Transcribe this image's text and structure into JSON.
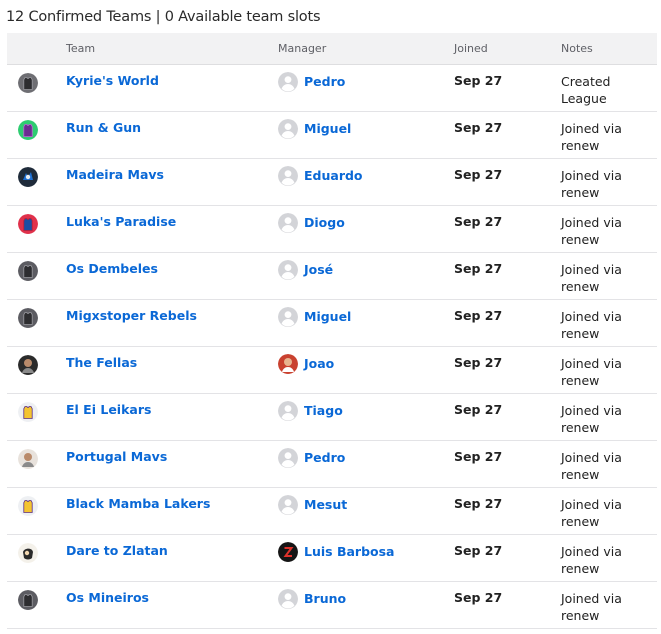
{
  "summary": "12 Confirmed Teams | 0 Available team slots",
  "columns": {
    "team": "Team",
    "manager": "Manager",
    "joined": "Joined",
    "notes": "Notes"
  },
  "rows": [
    {
      "logo_icon": "jersey-gray-logo-icon",
      "logo_bg": "#6e6e73",
      "team": "Kyrie's World",
      "avatar_icon": "default-user-icon",
      "manager": "Pedro",
      "joined": "Sep 27",
      "notes": "Created League"
    },
    {
      "logo_icon": "jersey-purple-logo-icon",
      "logo_bg": "#2ecc71",
      "team": "Run & Gun",
      "avatar_icon": "default-user-icon",
      "manager": "Miguel",
      "joined": "Sep 27",
      "notes": "Joined via renew"
    },
    {
      "logo_icon": "mavs-logo-icon",
      "logo_bg": "#1f2b3a",
      "team": "Madeira Mavs",
      "avatar_icon": "default-user-icon",
      "manager": "Eduardo",
      "joined": "Sep 27",
      "notes": "Joined via renew"
    },
    {
      "logo_icon": "jersey-blue-logo-icon",
      "logo_bg": "#e0314b",
      "team": "Luka's Paradise",
      "avatar_icon": "default-user-icon",
      "manager": "Diogo",
      "joined": "Sep 27",
      "notes": "Joined via renew"
    },
    {
      "logo_icon": "jersey-gray-logo-icon",
      "logo_bg": "#5c5c62",
      "team": "Os Dembeles",
      "avatar_icon": "default-user-icon",
      "manager": "José",
      "joined": "Sep 27",
      "notes": "Joined via renew"
    },
    {
      "logo_icon": "jersey-gray-logo-icon",
      "logo_bg": "#5c5c62",
      "team": "Migxstoper Rebels",
      "avatar_icon": "default-user-icon",
      "manager": "Miguel",
      "joined": "Sep 27",
      "notes": "Joined via renew"
    },
    {
      "logo_icon": "player-photo-logo-icon",
      "logo_bg": "#2b2b2b",
      "team": "The Fellas",
      "avatar_icon": "user-photo-avatar-icon",
      "manager": "Joao",
      "joined": "Sep 27",
      "notes": "Joined via renew"
    },
    {
      "logo_icon": "lakers-jersey-logo-icon",
      "logo_bg": "#eef0f3",
      "team": "El Ei Leikars",
      "avatar_icon": "default-user-icon",
      "manager": "Tiago",
      "joined": "Sep 27",
      "notes": "Joined via renew"
    },
    {
      "logo_icon": "player-photo-logo-icon",
      "logo_bg": "#e8e2dc",
      "team": "Portugal Mavs",
      "avatar_icon": "default-user-icon",
      "manager": "Pedro",
      "joined": "Sep 27",
      "notes": "Joined via renew"
    },
    {
      "logo_icon": "lakers-jersey-logo-icon",
      "logo_bg": "#eef0f3",
      "team": "Black Mamba Lakers",
      "avatar_icon": "default-user-icon",
      "manager": "Mesut",
      "joined": "Sep 27",
      "notes": "Joined via renew"
    },
    {
      "logo_icon": "cartoon-logo-icon",
      "logo_bg": "#f4f1ea",
      "team": "Dare to Zlatan",
      "avatar_icon": "letter-z-avatar-icon",
      "manager": "Luis Barbosa",
      "joined": "Sep 27",
      "notes": "Joined via renew"
    },
    {
      "logo_icon": "jersey-gray-logo-icon",
      "logo_bg": "#5c5c62",
      "team": "Os Mineiros",
      "avatar_icon": "default-user-icon",
      "manager": "Bruno",
      "joined": "Sep 27",
      "notes": "Joined via renew"
    }
  ],
  "colors": {
    "link": "#0a68d6",
    "header_bg": "#f2f2f3",
    "divider": "#e3e3e6"
  }
}
